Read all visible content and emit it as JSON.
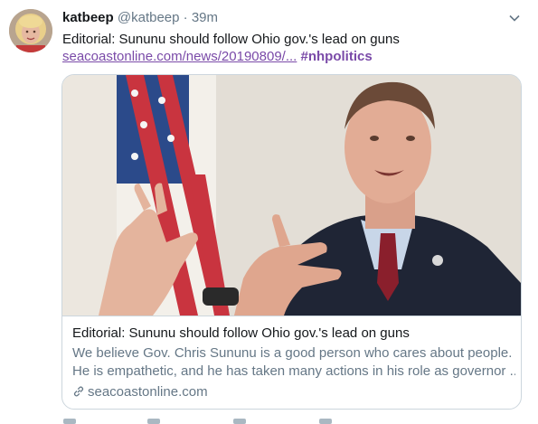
{
  "tweet": {
    "author_name": "katbeep",
    "author_handle": "@katbeep",
    "separator": "·",
    "time": "39m",
    "text": "Editorial: Sununu should follow Ohio gov.'s lead on guns",
    "url": "seacoastonline.com/news/20190809/...",
    "hashtag": "#nhpolitics"
  },
  "card": {
    "title": "Editorial: Sununu should follow Ohio gov.'s lead on guns",
    "description_line1": "We believe Gov. Chris Sununu is a good person who cares about people.",
    "description_line2": "He is empathetic, and he has taken many actions in his role as governor ...",
    "domain": "seacoastonline.com"
  },
  "icons": {
    "caret": "chevron-down-icon",
    "link": "link-icon"
  },
  "colors": {
    "link": "#7a4aa8",
    "secondary_text": "#657786",
    "primary_text": "#14171a",
    "border": "#ccd6dd"
  }
}
